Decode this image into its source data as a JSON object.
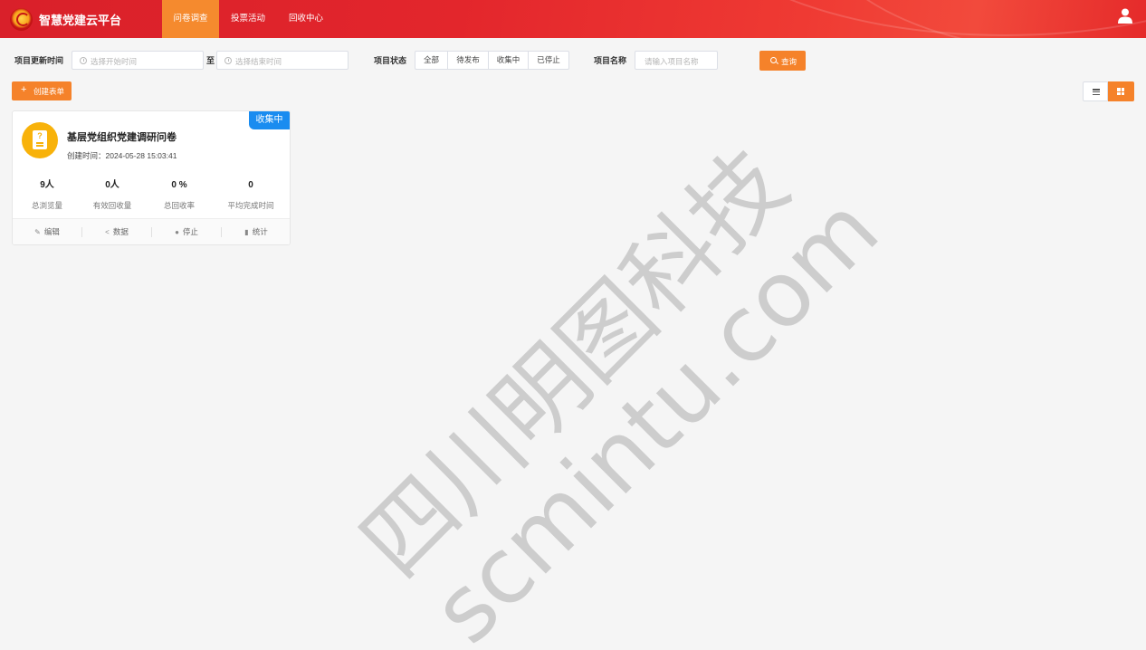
{
  "header": {
    "app_title": "智慧党建云平台",
    "nav": [
      {
        "label": "问卷调查",
        "active": true
      },
      {
        "label": "投票活动",
        "active": false
      },
      {
        "label": "回收中心",
        "active": false
      }
    ],
    "brand_color": "#e3262c",
    "accent_color": "#f58a2e"
  },
  "filters": {
    "update_time_label": "项目更新时间",
    "start_placeholder": "选择开始时间",
    "to_label": "至",
    "end_placeholder": "选择结束时间",
    "status_label": "项目状态",
    "status_options": [
      "全部",
      "待发布",
      "收集中",
      "已停止"
    ],
    "name_label": "项目名称",
    "name_placeholder": "请输入项目名称",
    "search_button": "查询"
  },
  "toolbar": {
    "create_button": "创建表单",
    "create_icon": "+",
    "view_mode": "grid"
  },
  "cards": [
    {
      "status_badge": "收集中",
      "status_color": "#1a8cf0",
      "title": "基层党组织党建调研问卷",
      "created": "创建时间：2024-05-28 15:03:41",
      "stats": [
        {
          "value": "9人",
          "label": "总浏览量"
        },
        {
          "value": "0人",
          "label": "有效回收量"
        },
        {
          "value": "0 %",
          "label": "总回收率"
        },
        {
          "value": "0",
          "label": "平均完成时间"
        }
      ],
      "actions": [
        {
          "icon": "edit-icon",
          "label": "编辑"
        },
        {
          "icon": "share-icon",
          "label": "数据"
        },
        {
          "icon": "stop-icon",
          "label": "停止"
        },
        {
          "icon": "bar-chart-icon",
          "label": "统计"
        }
      ]
    }
  ],
  "watermark": {
    "line1": "四川明图科技",
    "line2": "scmintu.com"
  }
}
